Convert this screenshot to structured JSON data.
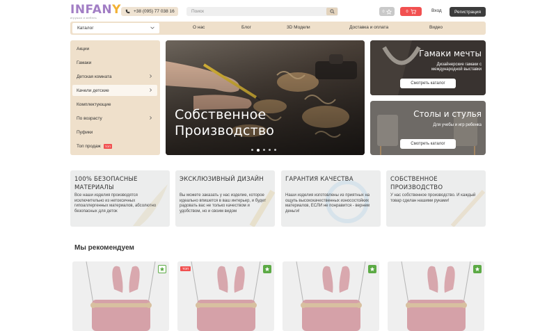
{
  "brand": {
    "name_left": "INFAN",
    "name_right": "Y",
    "tagline": "игрушки и мебель"
  },
  "header": {
    "phone": "+38 (095) 77 038 16",
    "search_placeholder": "Поиск",
    "favorites_count": "0",
    "cart_count": "0",
    "login_label": "Вход",
    "register_label": "Регистрация"
  },
  "nav": {
    "catalog_label": "Каталог",
    "links": [
      "О нас",
      "Блог",
      "3D Модели",
      "Доставка и оплата",
      "Видео"
    ]
  },
  "sidebar": {
    "items": [
      {
        "label": "Акции",
        "has_arrow": false
      },
      {
        "label": "Гамаки",
        "has_arrow": false
      },
      {
        "label": "Детская комната",
        "has_arrow": true
      },
      {
        "label": "Качели детские",
        "has_arrow": true,
        "active": true
      },
      {
        "label": "Комплектующие",
        "has_arrow": false
      },
      {
        "label": "По возрасту",
        "has_arrow": true
      },
      {
        "label": "Пуфики",
        "has_arrow": false
      },
      {
        "label": "Топ продаж",
        "has_arrow": false,
        "badge": "ТОП"
      }
    ]
  },
  "hero": {
    "title_line1": "Собственное",
    "title_line2": "Производство",
    "slide_count": 5,
    "active_slide": 1
  },
  "promos": [
    {
      "title": "Гамаки мечты",
      "subtitle_line1": "Дизайнерские гамаки с",
      "subtitle_line2": "международной выставки",
      "button": "Смотреть каталог"
    },
    {
      "title": "Столы и стулья",
      "subtitle_line1": "Для учебы и игр ребенка",
      "subtitle_line2": "",
      "button": "Смотреть каталог"
    }
  ],
  "features": [
    {
      "title": "100% БЕЗОПАСНЫЕ МАТЕРИАЛЫ",
      "text": "Все наши изделия производятся исключительно из нетоксичных гипоаллергенных материалов, абсолютно безопасных для деток"
    },
    {
      "title": "ЭКСКЛЮЗИВНЫЙ ДИЗАЙН",
      "text": "Вы можете заказать у нас изделие, которое идеально впишется в ваш интерьер, и будет радовать вас не только качеством и удобством, но и своим видом"
    },
    {
      "title": "ГАРАНТИЯ КАЧЕСТВА",
      "text": "Наши изделия изготовлены из приятных на ощупь высококачественных износостойких материалов, ЕСЛИ не понравится - вернем деньги!"
    },
    {
      "title": "СОБСТВЕННОЕ ПРОИЗВОДСТВО",
      "text": "У нас собственное производство. И каждый товар сделан нашими руками!"
    }
  ],
  "recommend": {
    "title": "Мы рекомендуем",
    "products": [
      {
        "badge": "",
        "favorite_active": false
      },
      {
        "badge": "ТОП",
        "favorite_active": true
      },
      {
        "badge": "",
        "favorite_active": true
      },
      {
        "badge": "",
        "favorite_active": true
      }
    ]
  },
  "colors": {
    "accent_beige": "#efe0cb",
    "cart_red": "#f15050",
    "dark_button": "#3c3c3c",
    "fav_green": "#5caa45",
    "logo_purple": "#a27ec5",
    "logo_yellow": "#f2b134"
  }
}
